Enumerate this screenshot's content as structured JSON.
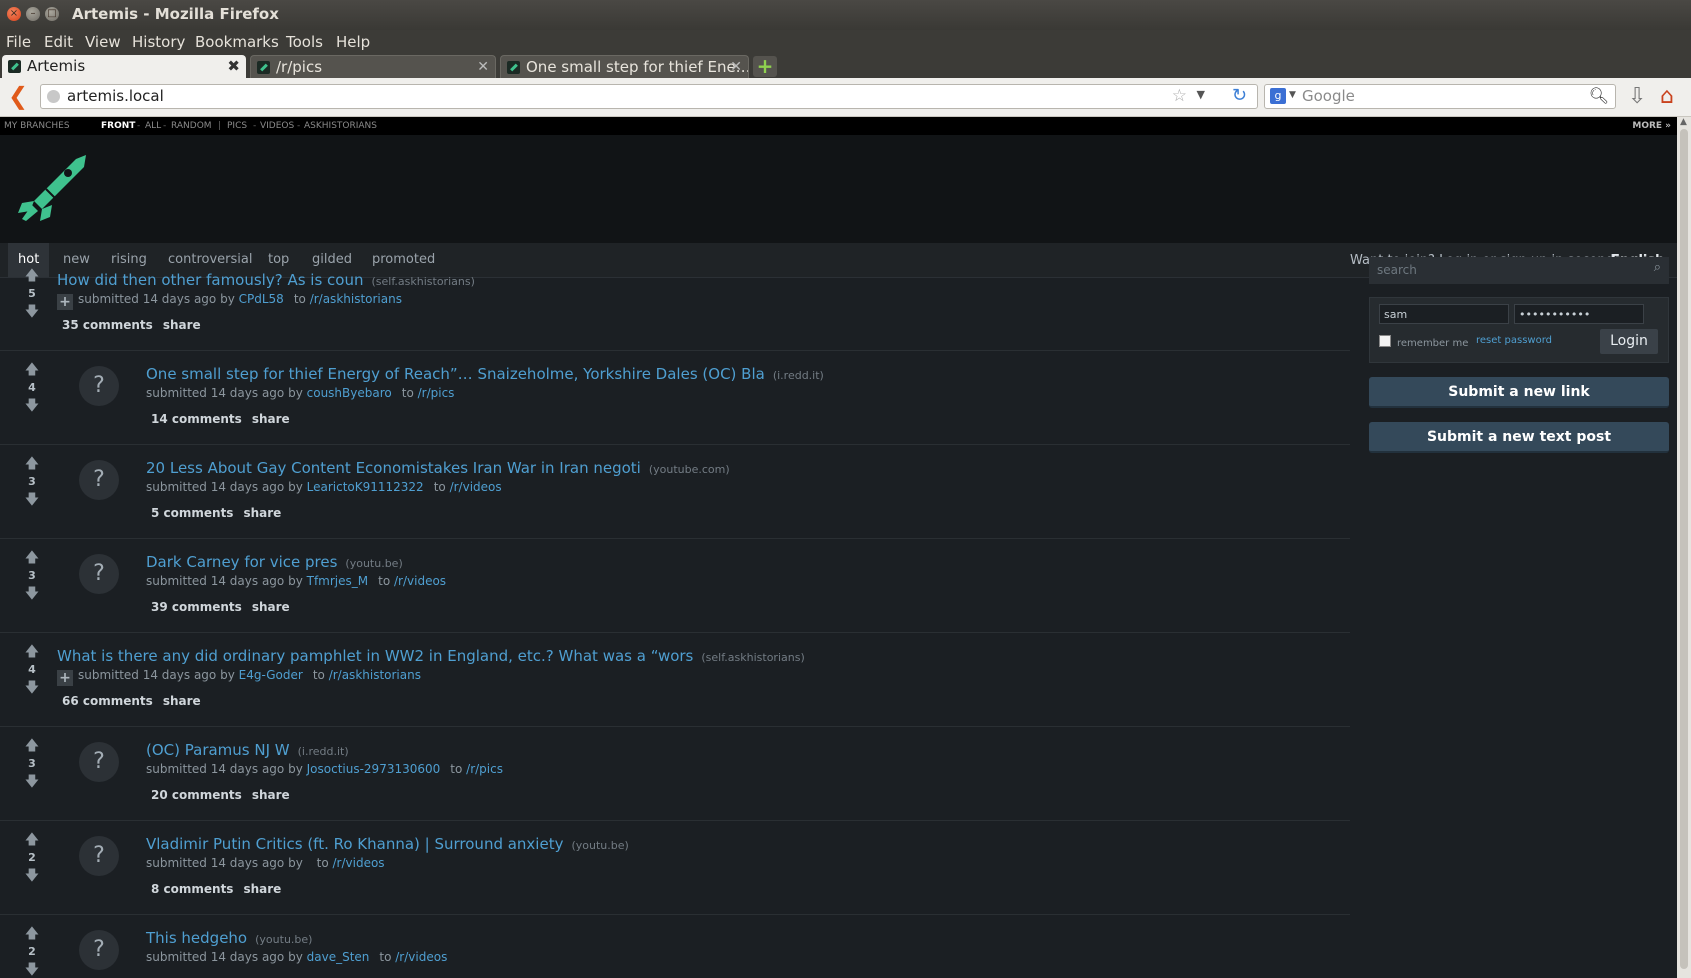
{
  "window": {
    "title": "Artemis - Mozilla Firefox"
  },
  "menu": [
    "File",
    "Edit",
    "View",
    "History",
    "Bookmarks",
    "Tools",
    "Help"
  ],
  "tabs": [
    {
      "label": "Artemis",
      "close": "✖"
    },
    {
      "label": "/r/pics",
      "close": "✕"
    },
    {
      "label": "One small step for thief Ene…",
      "close": "✕"
    }
  ],
  "newtab": "+",
  "address": {
    "url": "artemis.local"
  },
  "search_engine": {
    "placeholder": "Google"
  },
  "subreddit_bar": {
    "my_branches": "MY BRANCHES",
    "links": [
      "FRONT",
      "ALL",
      "RANDOM",
      "PICS",
      "VIDEOS",
      "ASKHISTORIANS"
    ],
    "dash": "-",
    "pipe": "|",
    "more": "MORE »"
  },
  "sort_tabs": [
    "hot",
    "new",
    "rising",
    "controversial",
    "top",
    "gilded",
    "promoted"
  ],
  "join_text": "Want to join? Log in or sign up in seconds.",
  "language": "English",
  "posts": [
    {
      "score": "5",
      "title": "How did then other famously? As is coun",
      "domain": "(self.askhistorians)",
      "by": "submitted 14 days ago by",
      "author": "CPdL58",
      "to": "to",
      "sub": "/r/askhistorians",
      "comments": "35 comments",
      "share": "share",
      "self": true
    },
    {
      "score": "4",
      "title": "One small step for thief Energy of Reach”… Snaizeholme, Yorkshire Dales (OC) Bla",
      "domain": "(i.redd.it)",
      "by": "submitted 14 days ago by",
      "author": "coushByebaro",
      "to": "to",
      "sub": "/r/pics",
      "comments": "14 comments",
      "share": "share",
      "self": false
    },
    {
      "score": "3",
      "title": "20 Less About Gay Content Economistakes Iran War in Iran negoti",
      "domain": "(youtube.com)",
      "by": "submitted 14 days ago by",
      "author": "LearictoK91112322",
      "to": "to",
      "sub": "/r/videos",
      "comments": "5 comments",
      "share": "share",
      "self": false
    },
    {
      "score": "3",
      "title": "Dark Carney for vice pres",
      "domain": "(youtu.be)",
      "by": "submitted 14 days ago by",
      "author": "Tfmrjes_M",
      "to": "to",
      "sub": "/r/videos",
      "comments": "39 comments",
      "share": "share",
      "self": false
    },
    {
      "score": "4",
      "title": "What is there any did ordinary pamphlet in WW2 in England, etc.? What was a “wors",
      "domain": "(self.askhistorians)",
      "by": "submitted 14 days ago by",
      "author": "E4g-Goder",
      "to": "to",
      "sub": "/r/askhistorians",
      "comments": "66 comments",
      "share": "share",
      "self": true
    },
    {
      "score": "3",
      "title": "(OC) Paramus NJ W",
      "domain": "(i.redd.it)",
      "by": "submitted 14 days ago by",
      "author": "Josoctius-2973130600",
      "to": "to",
      "sub": "/r/pics",
      "comments": "20 comments",
      "share": "share",
      "self": false
    },
    {
      "score": "2",
      "title": "Vladimir Putin Critics (ft. Ro Khanna) | Surround anxiety",
      "domain": "(youtu.be)",
      "by": "submitted 14 days ago by",
      "author": "",
      "to": "to",
      "sub": "/r/videos",
      "comments": "8 comments",
      "share": "share",
      "self": false
    },
    {
      "score": "2",
      "title": "This hedgeho",
      "domain": "(youtu.be)",
      "by": "submitted 14 days ago by",
      "author": "dave_Sten",
      "to": "to",
      "sub": "/r/videos",
      "comments": "",
      "share": "",
      "self": false
    }
  ],
  "sidebar": {
    "search_placeholder": "search",
    "username": "sam",
    "password": "•••••••••••",
    "remember": "remember me",
    "reset": "reset password",
    "login": "Login",
    "submit_link": "Submit a new link",
    "submit_text": "Submit a new text post"
  },
  "glyphs": {
    "up": "🡅",
    "down": "🡇",
    "question": "?",
    "plus": "+"
  },
  "colors": {
    "link": "#4f9fd1",
    "page_bg": "#1b1f23",
    "header_bg": "#111416",
    "accent_logo": "#3fc28e"
  }
}
